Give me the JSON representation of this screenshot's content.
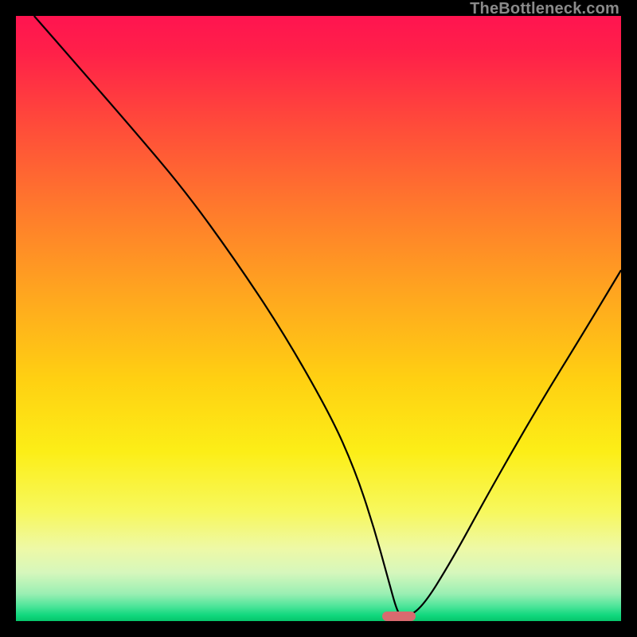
{
  "watermark": "TheBottleneck.com",
  "chart_data": {
    "type": "line",
    "title": "",
    "xlabel": "",
    "ylabel": "",
    "xlim": [
      0,
      100
    ],
    "ylim": [
      0,
      100
    ],
    "grid": false,
    "legend": false,
    "gradient_stops": [
      {
        "pos": 0,
        "color": "#ff1450"
      },
      {
        "pos": 0.06,
        "color": "#ff2049"
      },
      {
        "pos": 0.18,
        "color": "#ff4b3a"
      },
      {
        "pos": 0.32,
        "color": "#ff7a2c"
      },
      {
        "pos": 0.46,
        "color": "#ffa61f"
      },
      {
        "pos": 0.6,
        "color": "#ffd012"
      },
      {
        "pos": 0.72,
        "color": "#fcee17"
      },
      {
        "pos": 0.82,
        "color": "#f7f85e"
      },
      {
        "pos": 0.88,
        "color": "#eef9a6"
      },
      {
        "pos": 0.92,
        "color": "#d6f7bc"
      },
      {
        "pos": 0.955,
        "color": "#9aefb3"
      },
      {
        "pos": 0.975,
        "color": "#4fe59a"
      },
      {
        "pos": 0.99,
        "color": "#12d87e"
      },
      {
        "pos": 1.0,
        "color": "#06c66b"
      }
    ],
    "series": [
      {
        "name": "bottleneck-curve",
        "x": [
          3,
          10,
          20,
          28,
          36,
          44,
          52,
          56,
          59,
          61.5,
          63,
          64,
          67,
          72,
          78,
          86,
          94,
          100
        ],
        "y": [
          100,
          92,
          80.5,
          71,
          60,
          48,
          34,
          25,
          16,
          7,
          1.5,
          0.5,
          2,
          10,
          21,
          35,
          48,
          58
        ]
      }
    ],
    "optimal_marker": {
      "x_start": 60.5,
      "x_end": 66,
      "y": 0.5
    }
  }
}
